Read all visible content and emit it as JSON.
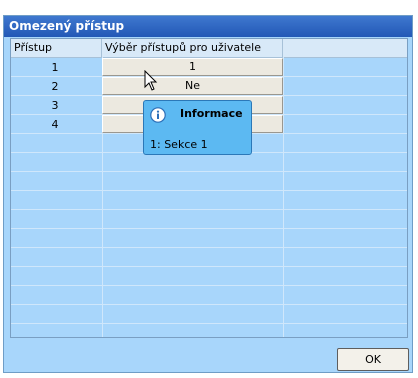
{
  "window": {
    "title": "Omezený přístup"
  },
  "table": {
    "columns": [
      "Přístup",
      "Výběr přístupů pro uživatele"
    ],
    "rows": [
      {
        "access": "1",
        "selection": "1"
      },
      {
        "access": "2",
        "selection": "Ne"
      },
      {
        "access": "3",
        "selection": ""
      },
      {
        "access": "4",
        "selection": ""
      }
    ]
  },
  "tooltip": {
    "title": "Informace",
    "body": "1: Sekce 1",
    "icon": "info-icon"
  },
  "footer": {
    "ok_label": "OK"
  },
  "colors": {
    "title_bar": "#2258b6",
    "grid_bg": "#a8d6fb",
    "tooltip_bg": "#5cb9f2"
  }
}
